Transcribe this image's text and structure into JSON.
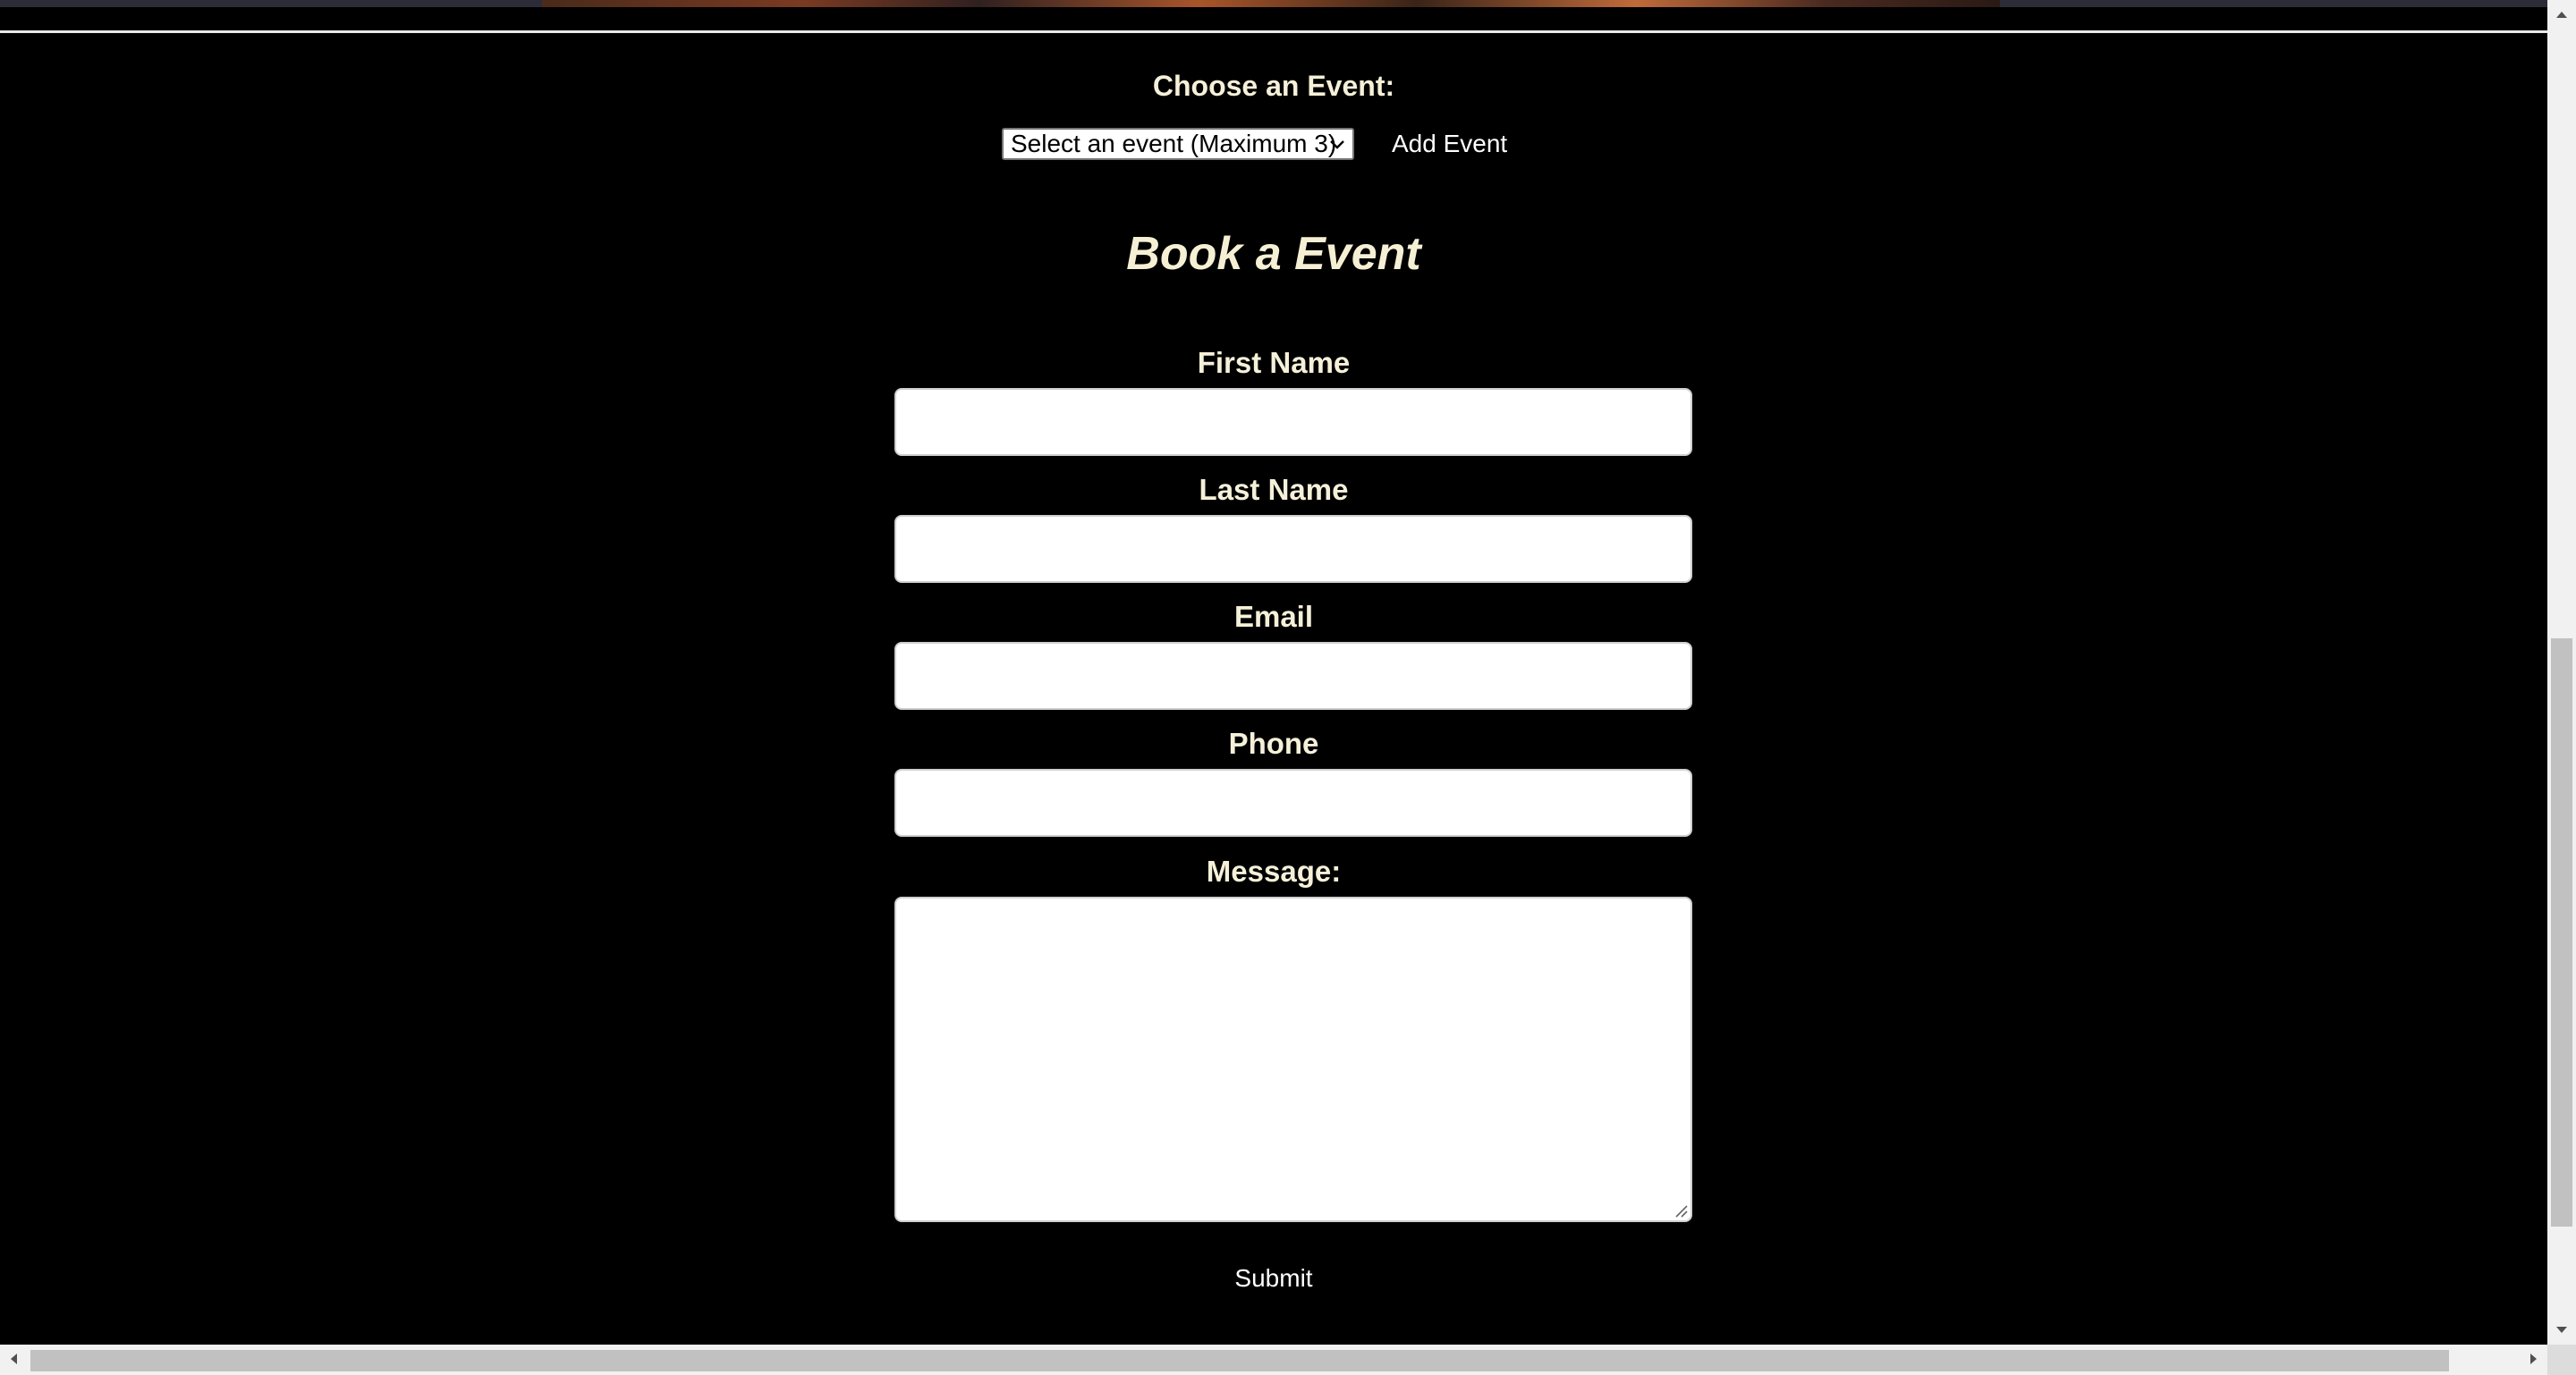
{
  "event_picker": {
    "heading": "Choose an Event:",
    "select_value": "Select an event (Maximum 3)",
    "add_button_label": "Add Event"
  },
  "form": {
    "title": "Book a Event",
    "fields": {
      "first_name": {
        "label": "First Name",
        "value": ""
      },
      "last_name": {
        "label": "Last Name",
        "value": ""
      },
      "email": {
        "label": "Email",
        "value": ""
      },
      "phone": {
        "label": "Phone",
        "value": ""
      },
      "message": {
        "label": "Message:",
        "value": ""
      }
    },
    "submit_label": "Submit"
  },
  "colors": {
    "background": "#000000",
    "label_text": "#f5f0d8",
    "button_text": "#ffffff",
    "input_background": "#ffffff"
  }
}
